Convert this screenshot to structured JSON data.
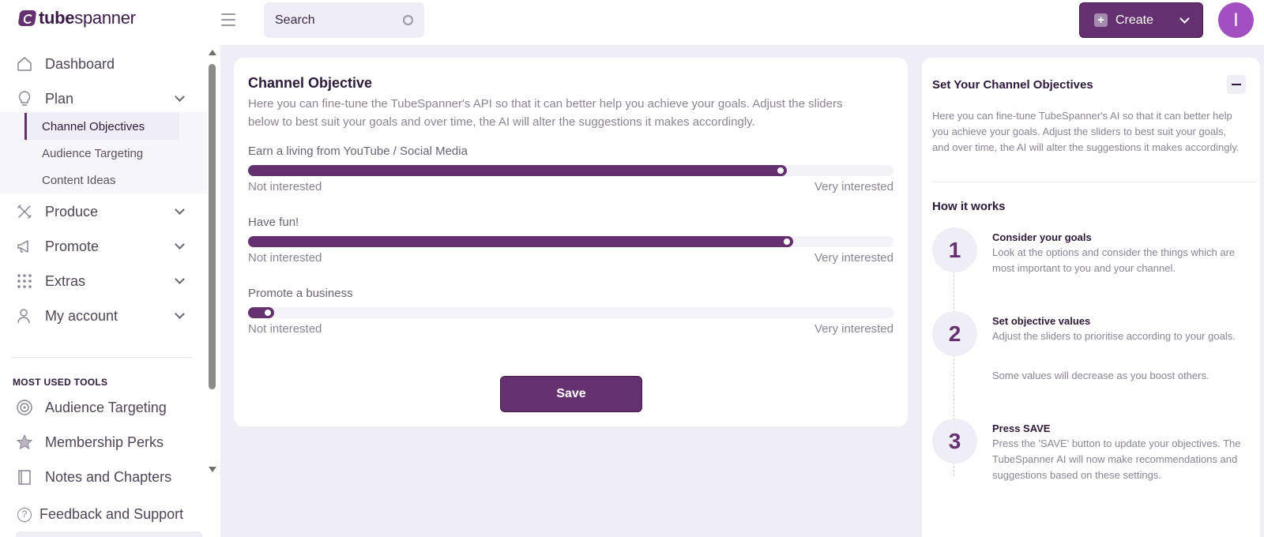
{
  "brand": {
    "bold": "tube",
    "light": "spanner"
  },
  "search": {
    "placeholder": "Search"
  },
  "create": {
    "label": "Create"
  },
  "avatar": {
    "initial": "I"
  },
  "sidebar": {
    "items": [
      {
        "label": "Dashboard",
        "icon": "home-icon"
      },
      {
        "label": "Plan",
        "icon": "lightbulb-icon",
        "expanded": true
      },
      {
        "label": "Produce",
        "icon": "tools-icon"
      },
      {
        "label": "Promote",
        "icon": "megaphone-icon"
      },
      {
        "label": "Extras",
        "icon": "dots-grid-icon"
      },
      {
        "label": "My account",
        "icon": "user-icon"
      }
    ],
    "plan_subitems": [
      {
        "label": "Channel Objectives",
        "active": true
      },
      {
        "label": "Audience Targeting"
      },
      {
        "label": "Content Ideas"
      }
    ],
    "tools_title": "MOST USED TOOLS",
    "tools": [
      {
        "label": "Audience Targeting",
        "icon": "target-icon"
      },
      {
        "label": "Membership Perks",
        "icon": "star-icon"
      },
      {
        "label": "Notes and Chapters",
        "icon": "notebook-icon"
      }
    ],
    "feedback": "Feedback and Support"
  },
  "main": {
    "title": "Channel Objective",
    "description": "Here you can fine-tune the TubeSpanner's API so that it can better help you achieve your goals. Adjust the sliders below to best suit your goals and over time, the AI will alter the suggestions it makes accordingly.",
    "sliders": [
      {
        "label": "Earn a living from YouTube / Social Media",
        "value": 0.835,
        "min_label": "Not interested",
        "max_label": "Very interested"
      },
      {
        "label": "Have fun!",
        "value": 0.845,
        "min_label": "Not interested",
        "max_label": "Very interested"
      },
      {
        "label": "Promote a business",
        "value": 0.04,
        "min_label": "Not interested",
        "max_label": "Very interested"
      }
    ],
    "save_label": "Save"
  },
  "side": {
    "title": "Set Your Channel Objectives",
    "description": "Here you can fine-tune TubeSpanner's AI so that it can better help you achieve your goals. Adjust the sliders to best suit your goals, and over time, the AI will alter the suggestions it makes accordingly.",
    "how_title": "How it works",
    "steps": [
      {
        "num": "1",
        "head": "Consider your goals",
        "text": "Look at the options and consider the things which are most important to you and your channel.",
        "extra": ""
      },
      {
        "num": "2",
        "head": "Set objective values",
        "text": "Adjust the sliders to prioritise according to your goals.",
        "extra": "Some values will decrease as you boost others."
      },
      {
        "num": "3",
        "head": "Press SAVE",
        "text": "Press the 'SAVE' button to update your objectives. The TubeSpanner AI will now make recommendations and suggestions based on these settings.",
        "extra": ""
      }
    ]
  },
  "colors": {
    "accent": "#65306f",
    "background": "#efedf6",
    "avatar": "#a24fc0"
  }
}
